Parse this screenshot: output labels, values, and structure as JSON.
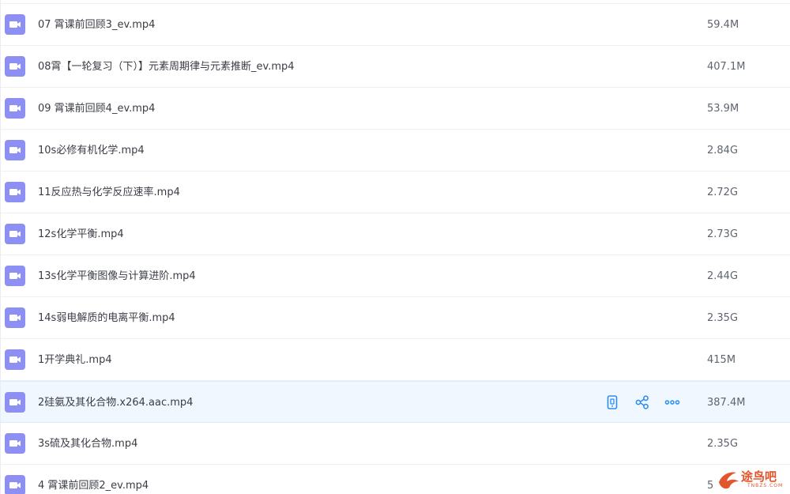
{
  "files": [
    {
      "name": "07 霄课前回顾3_ev.mp4",
      "size": "59.4M",
      "icon": "video-file-icon"
    },
    {
      "name": "08霄【一轮复习（下）】元素周期律与元素推断_ev.mp4",
      "size": "407.1M",
      "icon": "video-file-icon"
    },
    {
      "name": "09 霄课前回顾4_ev.mp4",
      "size": "53.9M",
      "icon": "video-file-icon"
    },
    {
      "name": "10s必修有机化学.mp4",
      "size": "2.84G",
      "icon": "video-file-icon"
    },
    {
      "name": "11反应热与化学反应速率.mp4",
      "size": "2.72G",
      "icon": "video-file-icon"
    },
    {
      "name": "12s化学平衡.mp4",
      "size": "2.73G",
      "icon": "video-file-icon"
    },
    {
      "name": "13s化学平衡图像与计算进阶.mp4",
      "size": "2.44G",
      "icon": "video-file-icon"
    },
    {
      "name": "14s弱电解质的电离平衡.mp4",
      "size": "2.35G",
      "icon": "video-file-icon"
    },
    {
      "name": "1开学典礼.mp4",
      "size": "415M",
      "icon": "video-file-icon"
    },
    {
      "name": "2硅氨及其化合物.x264.aac.mp4",
      "size": "387.4M",
      "icon": "video-file-icon",
      "selected": true
    },
    {
      "name": "3s硫及其化合物.mp4",
      "size": "2.35G",
      "icon": "video-file-icon"
    },
    {
      "name": "4 霄课前回顾2_ev.mp4",
      "size": "5",
      "icon": "video-file-icon"
    }
  ],
  "row_actions": [
    {
      "name": "phone-icon",
      "label": "phone"
    },
    {
      "name": "share-icon",
      "label": "share"
    },
    {
      "name": "more-icon",
      "label": "more"
    }
  ],
  "watermark": {
    "text": "途鸟吧",
    "sub": "TNBZS.COM"
  },
  "colors": {
    "icon_bg": "#8d8ff3",
    "accent": "#2a8ef0",
    "selected_row": "#f1f7fe",
    "watermark": "#e2562c"
  }
}
